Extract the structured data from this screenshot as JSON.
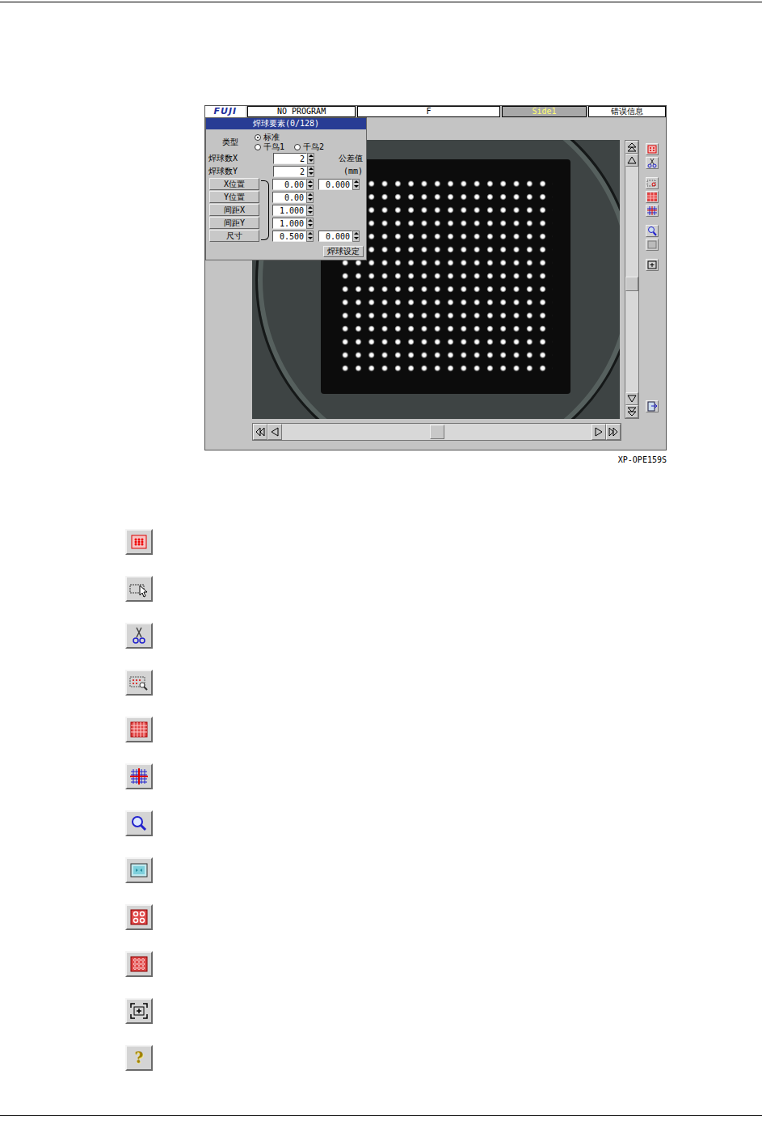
{
  "page": {
    "caption": "XP-OPE159S",
    "help_icon": "?"
  },
  "screen": {
    "logo": "FUJI",
    "header": {
      "program": "NO PROGRAM",
      "mode": "F",
      "side": "Side1",
      "error": "错误信息"
    },
    "dialog": {
      "title": "焊球要素(0/128)",
      "type_label": "类型",
      "types": [
        {
          "label": "标准",
          "selected": true
        },
        {
          "label": "千鸟1",
          "selected": false
        },
        {
          "label": "千鸟2",
          "selected": false
        }
      ],
      "counts": [
        {
          "label": "焊球数X",
          "value": "2"
        },
        {
          "label": "焊球数Y",
          "value": "2"
        }
      ],
      "tolerance_label": "公差值",
      "unit": "(mm)",
      "params": [
        {
          "label": "X位置",
          "value": "0.00",
          "tolerance": "0.000"
        },
        {
          "label": "Y位置",
          "value": "0.00"
        },
        {
          "label": "间距X",
          "value": "1.000"
        },
        {
          "label": "间距Y",
          "value": "1.000"
        },
        {
          "label": "尺寸",
          "value": "0.500",
          "tolerance": "0.000"
        }
      ],
      "set_button": "焊球设定"
    },
    "vertical_scroll": {
      "level": 0.52
    },
    "horizontal_scroll": {
      "level": 0.5
    }
  }
}
